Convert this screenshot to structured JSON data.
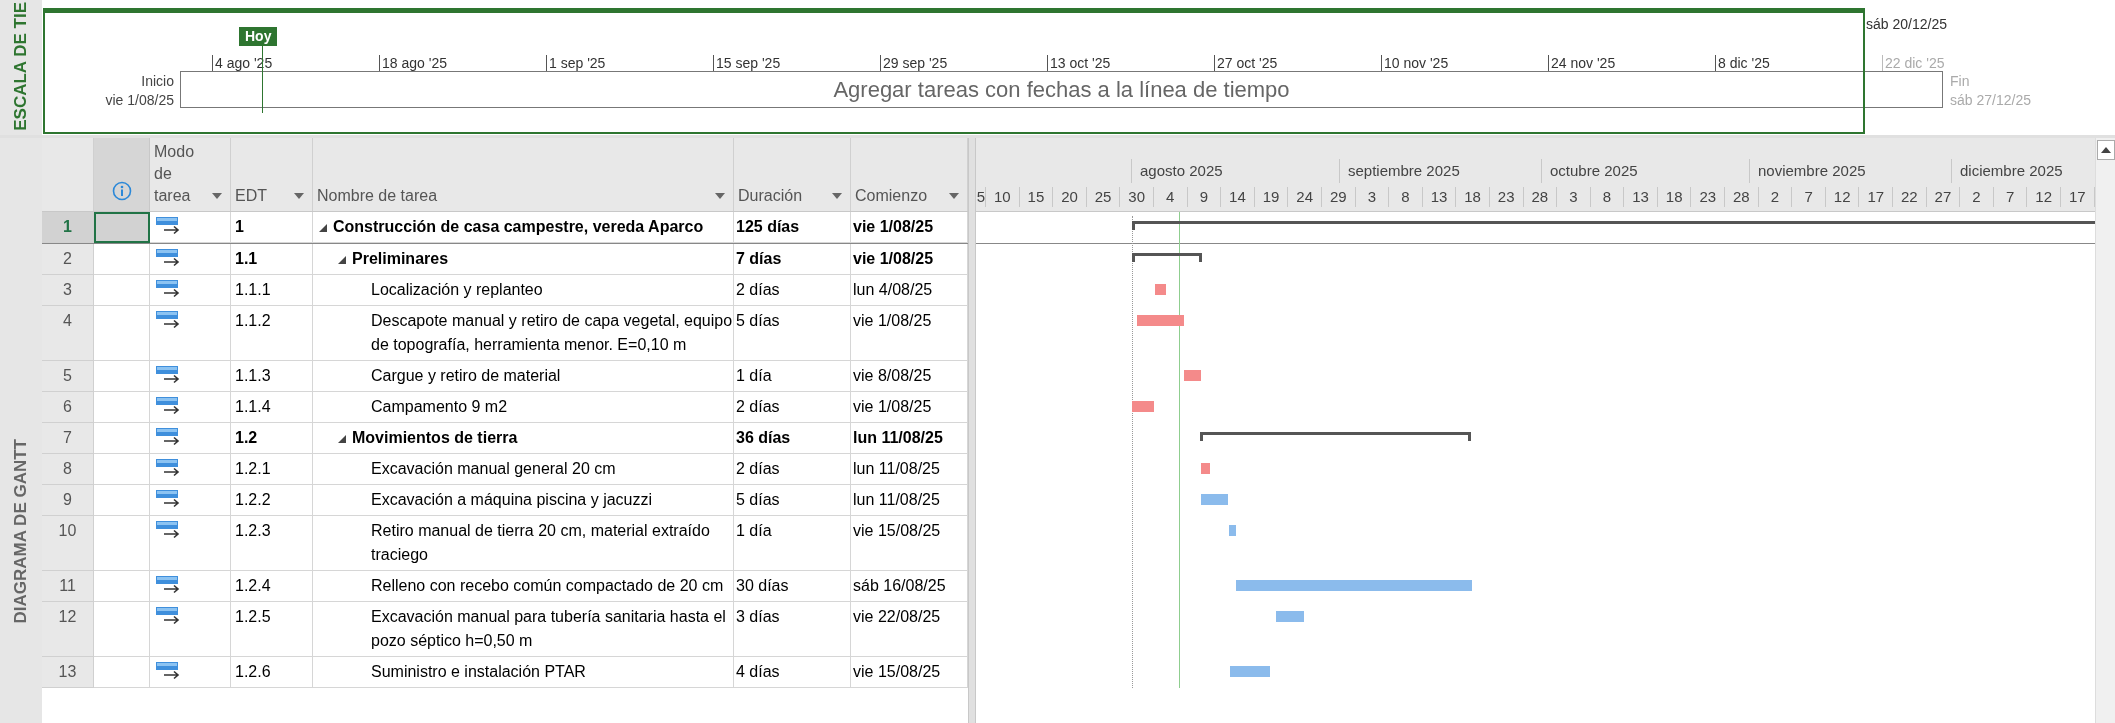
{
  "timeline": {
    "side_label": "ESCALA DE TIE",
    "today": "Hoy",
    "view_end_date": "sáb 20/12/25",
    "start_label": "Inicio",
    "start_date": "vie 1/08/25",
    "end_label": "Fin",
    "end_date": "sáb 27/12/25",
    "prompt": "Agregar tareas con fechas a la línea de tiempo",
    "ticks": [
      {
        "label": "4 ago '25",
        "in_view": true
      },
      {
        "label": "18 ago '25",
        "in_view": true
      },
      {
        "label": "1 sep '25",
        "in_view": true
      },
      {
        "label": "15 sep '25",
        "in_view": true
      },
      {
        "label": "29 sep '25",
        "in_view": true
      },
      {
        "label": "13 oct '25",
        "in_view": true
      },
      {
        "label": "27 oct '25",
        "in_view": true
      },
      {
        "label": "10 nov '25",
        "in_view": true
      },
      {
        "label": "24 nov '25",
        "in_view": true
      },
      {
        "label": "8 dic '25",
        "in_view": true
      },
      {
        "label": "22 dic '25",
        "in_view": false
      }
    ]
  },
  "gantt": {
    "side_label": "DIAGRAMA DE GANTT",
    "columns": [
      "Modo de tarea",
      "EDT",
      "Nombre de tarea",
      "Duración",
      "Comienzo"
    ],
    "months": [
      "agosto 2025",
      "septiembre 2025",
      "octubre 2025",
      "noviembre 2025",
      "diciembre 2025"
    ],
    "days": [
      "5",
      "10",
      "15",
      "20",
      "25",
      "30",
      "4",
      "9",
      "14",
      "19",
      "24",
      "29",
      "3",
      "8",
      "13",
      "18",
      "23",
      "28",
      "3",
      "8",
      "13",
      "18",
      "23",
      "28",
      "2",
      "7",
      "12",
      "17",
      "22",
      "27",
      "2",
      "7",
      "12",
      "17"
    ],
    "tasks": [
      {
        "row": "1",
        "edt": "1",
        "name": "Construcción de casa campestre, vereda Aparco",
        "duration": "125 días",
        "start": "vie 1/08/25",
        "kind": "summary",
        "expanded": true,
        "selected": true,
        "children": [
          {
            "row": "2",
            "edt": "1.1",
            "name": "Preliminares",
            "duration": "7 días",
            "start": "vie 1/08/25",
            "kind": "summary",
            "expanded": true,
            "selected": false,
            "children": [
              {
                "row": "3",
                "edt": "1.1.1",
                "name": "Localización y replanteo",
                "duration": "2 días",
                "start": "lun 4/08/25",
                "kind": "task",
                "critical": true,
                "selected": false
              },
              {
                "row": "4",
                "edt": "1.1.2",
                "name": "Descapote manual y retiro de capa vegetal, equipo de topografía, herramienta menor. E=0,10 m",
                "duration": "5 días",
                "start": "vie 1/08/25",
                "kind": "task",
                "critical": true,
                "selected": false
              },
              {
                "row": "5",
                "edt": "1.1.3",
                "name": "Cargue y retiro de material",
                "duration": "1 día",
                "start": "vie 8/08/25",
                "kind": "task",
                "critical": true,
                "selected": false
              },
              {
                "row": "6",
                "edt": "1.1.4",
                "name": "Campamento 9 m2",
                "duration": "2 días",
                "start": "vie 1/08/25",
                "kind": "task",
                "critical": true,
                "selected": false
              }
            ]
          },
          {
            "row": "7",
            "edt": "1.2",
            "name": "Movimientos de tierra",
            "duration": "36 días",
            "start": "lun 11/08/25",
            "kind": "summary",
            "expanded": true,
            "selected": false,
            "children": [
              {
                "row": "8",
                "edt": "1.2.1",
                "name": "Excavación manual general 20 cm",
                "duration": "2 días",
                "start": "lun 11/08/25",
                "kind": "task",
                "critical": true,
                "selected": false
              },
              {
                "row": "9",
                "edt": "1.2.2",
                "name": "Excavación a máquina piscina y jacuzzi",
                "duration": "5 días",
                "start": "lun 11/08/25",
                "kind": "task",
                "critical": false,
                "selected": false
              },
              {
                "row": "10",
                "edt": "1.2.3",
                "name": "Retiro manual de tierra 20 cm, material extraído traciego",
                "duration": "1 día",
                "start": "vie 15/08/25",
                "kind": "task",
                "critical": false,
                "selected": false
              },
              {
                "row": "11",
                "edt": "1.2.4",
                "name": "Relleno con recebo común compactado de 20 cm",
                "duration": "30 días",
                "start": "sáb 16/08/25",
                "kind": "task",
                "critical": false,
                "selected": false
              },
              {
                "row": "12",
                "edt": "1.2.5",
                "name": "Excavación manual para tubería sanitaria hasta el pozo séptico h=0,50 m",
                "duration": "3 días",
                "start": "vie 22/08/25",
                "kind": "task",
                "critical": false,
                "selected": false
              },
              {
                "row": "13",
                "edt": "1.2.6",
                "name": "Suministro e instalación PTAR",
                "duration": "4 días",
                "start": "vie 15/08/25",
                "kind": "task",
                "critical": false,
                "selected": false
              }
            ]
          }
        ]
      }
    ]
  }
}
